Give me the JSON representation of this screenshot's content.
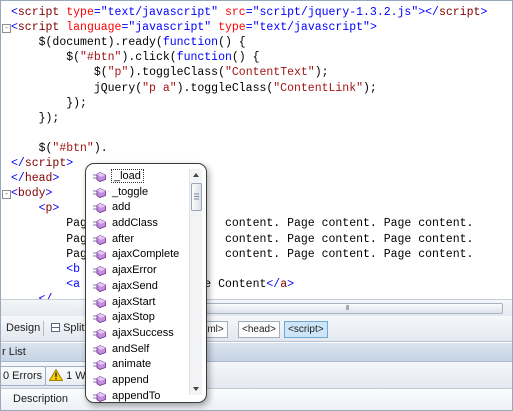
{
  "editor": {
    "lines": [
      {
        "indent": "",
        "tokens": [
          {
            "t": "<",
            "c": "b"
          },
          {
            "t": "script",
            "c": "m"
          },
          {
            "t": " ",
            "c": "k"
          },
          {
            "t": "type",
            "c": "r"
          },
          {
            "t": "=",
            "c": "b"
          },
          {
            "t": "\"text/javascript\"",
            "c": "b"
          },
          {
            "t": " ",
            "c": "k"
          },
          {
            "t": "src",
            "c": "r"
          },
          {
            "t": "=",
            "c": "b"
          },
          {
            "t": "\"script/jquery-1.3.2.js\"",
            "c": "b"
          },
          {
            "t": "></",
            "c": "b"
          },
          {
            "t": "script",
            "c": "m"
          },
          {
            "t": ">",
            "c": "b"
          }
        ]
      },
      {
        "indent": "",
        "collapse": "-",
        "tokens": [
          {
            "t": "<",
            "c": "b"
          },
          {
            "t": "script",
            "c": "m"
          },
          {
            "t": " ",
            "c": "k"
          },
          {
            "t": "language",
            "c": "r"
          },
          {
            "t": "=",
            "c": "b"
          },
          {
            "t": "\"javascript\"",
            "c": "b"
          },
          {
            "t": " ",
            "c": "k"
          },
          {
            "t": "type",
            "c": "r"
          },
          {
            "t": "=",
            "c": "b"
          },
          {
            "t": "\"text/javascript\"",
            "c": "b"
          },
          {
            "t": ">",
            "c": "b"
          }
        ]
      },
      {
        "indent": "    ",
        "tokens": [
          {
            "t": "$(document).ready(",
            "c": "k"
          },
          {
            "t": "function",
            "c": "b"
          },
          {
            "t": "() {",
            "c": "k"
          }
        ]
      },
      {
        "indent": "        ",
        "tokens": [
          {
            "t": "$(",
            "c": "k"
          },
          {
            "t": "\"#btn\"",
            "c": "s"
          },
          {
            "t": ").click(",
            "c": "k"
          },
          {
            "t": "function",
            "c": "b"
          },
          {
            "t": "() {",
            "c": "k"
          }
        ]
      },
      {
        "indent": "            ",
        "tokens": [
          {
            "t": "$(",
            "c": "k"
          },
          {
            "t": "\"p\"",
            "c": "s"
          },
          {
            "t": ").toggleClass(",
            "c": "k"
          },
          {
            "t": "\"ContentText\"",
            "c": "s"
          },
          {
            "t": ");",
            "c": "k"
          }
        ]
      },
      {
        "indent": "            ",
        "tokens": [
          {
            "t": "jQuery(",
            "c": "k"
          },
          {
            "t": "\"p a\"",
            "c": "s"
          },
          {
            "t": ").toggleClass(",
            "c": "k"
          },
          {
            "t": "\"ContentLink\"",
            "c": "s"
          },
          {
            "t": ");",
            "c": "k"
          }
        ]
      },
      {
        "indent": "        ",
        "tokens": [
          {
            "t": "});",
            "c": "k"
          }
        ]
      },
      {
        "indent": "    ",
        "tokens": [
          {
            "t": "});",
            "c": "k"
          }
        ]
      },
      {
        "indent": "",
        "tokens": []
      },
      {
        "indent": "    ",
        "tokens": [
          {
            "t": "$(",
            "c": "k"
          },
          {
            "t": "\"#btn\"",
            "c": "s"
          },
          {
            "t": ").",
            "c": "k"
          }
        ]
      },
      {
        "indent": "",
        "tokens": [
          {
            "t": "</",
            "c": "b"
          },
          {
            "t": "script",
            "c": "m"
          },
          {
            "t": ">",
            "c": "b"
          }
        ]
      },
      {
        "indent": "",
        "tokens": [
          {
            "t": "</",
            "c": "b"
          },
          {
            "t": "head",
            "c": "m"
          },
          {
            "t": ">",
            "c": "b"
          }
        ]
      },
      {
        "indent": "",
        "collapse": "-",
        "tokens": [
          {
            "t": "<",
            "c": "b"
          },
          {
            "t": "body",
            "c": "m"
          },
          {
            "t": ">",
            "c": "b"
          }
        ]
      },
      {
        "indent": "    ",
        "tokens": [
          {
            "t": "<",
            "c": "b"
          },
          {
            "t": "p",
            "c": "m"
          },
          {
            "t": ">",
            "c": "b"
          }
        ]
      },
      {
        "indent": "        ",
        "tokens": [
          {
            "t": "Pag",
            "c": "k"
          },
          {
            "t": "                    ",
            "c": "k"
          },
          {
            "t": "content. Page content. Page content.",
            "c": "k"
          }
        ]
      },
      {
        "indent": "        ",
        "tokens": [
          {
            "t": "Pag",
            "c": "k"
          },
          {
            "t": "                    ",
            "c": "k"
          },
          {
            "t": "content. Page content. Page content.",
            "c": "k"
          }
        ]
      },
      {
        "indent": "        ",
        "tokens": [
          {
            "t": "Pag",
            "c": "k"
          },
          {
            "t": "                    ",
            "c": "k"
          },
          {
            "t": "content. Page content. Page content.",
            "c": "k"
          }
        ]
      },
      {
        "indent": "        ",
        "tokens": [
          {
            "t": "<b",
            "c": "b"
          }
        ]
      },
      {
        "indent": "        ",
        "tokens": [
          {
            "t": "<a",
            "c": "b"
          },
          {
            "t": "               ",
            "c": "k"
          },
          {
            "t": "Page Content",
            "c": "k"
          },
          {
            "t": "</",
            "c": "b"
          },
          {
            "t": "a",
            "c": "m"
          },
          {
            "t": ">",
            "c": "b"
          }
        ]
      },
      {
        "indent": "    ",
        "tokens": [
          {
            "t": "</",
            "c": "b"
          }
        ]
      }
    ]
  },
  "hscroll": {
    "grip": "III"
  },
  "viewbar": {
    "design": "Design",
    "split": "Split",
    "crumbs": [
      "html>",
      "<head>",
      "<script>"
    ]
  },
  "errors": {
    "title": "r List",
    "errors_btn": "0 Errors",
    "warnings_btn": "1 Wa",
    "col_description": "Description"
  },
  "popup": {
    "items": [
      "_load",
      "_toggle",
      "add",
      "addClass",
      "after",
      "ajaxComplete",
      "ajaxError",
      "ajaxSend",
      "ajaxStart",
      "ajaxStop",
      "ajaxSuccess",
      "andSelf",
      "animate",
      "append",
      "appendTo"
    ],
    "selected_index": 0
  },
  "colors": {
    "keyword": "#0000ff",
    "tag": "#800000",
    "attr": "#ff0000",
    "string": "#a31515",
    "crumb_active": "#cde6f7"
  }
}
